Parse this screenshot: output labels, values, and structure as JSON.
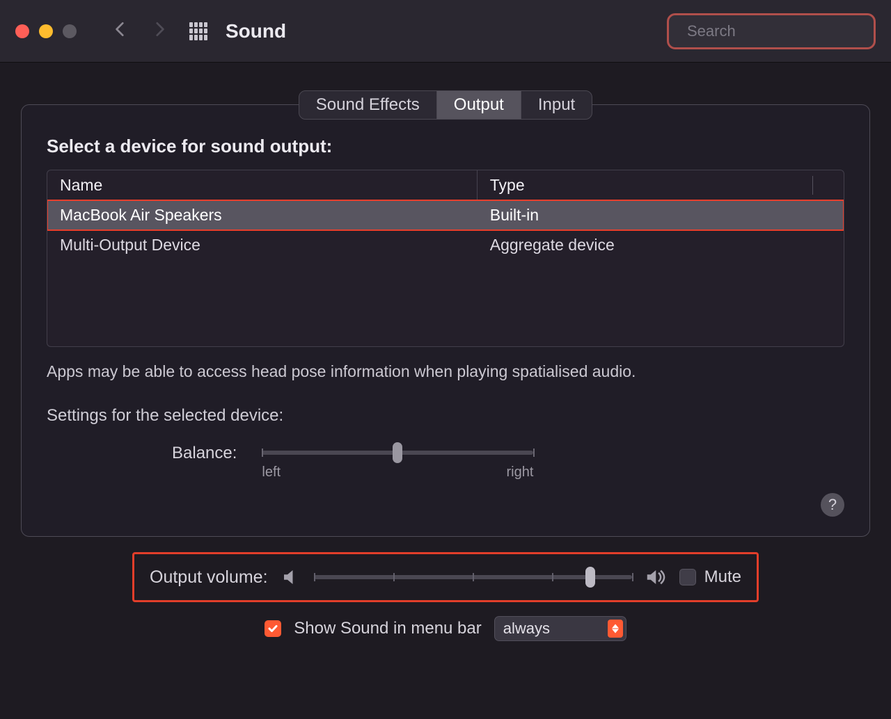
{
  "header": {
    "title": "Sound",
    "search_placeholder": "Search"
  },
  "tabs": {
    "sound_effects": "Sound Effects",
    "output": "Output",
    "input": "Input",
    "active": "output"
  },
  "output_panel": {
    "select_device_title": "Select a device for sound output:",
    "columns": {
      "name": "Name",
      "type": "Type"
    },
    "devices": [
      {
        "name": "MacBook Air Speakers",
        "type": "Built-in",
        "selected": true
      },
      {
        "name": "Multi-Output Device",
        "type": "Aggregate device",
        "selected": false
      }
    ],
    "spatial_note": "Apps may be able to access head pose information when playing spatialised audio.",
    "settings_heading": "Settings for the selected device:",
    "balance": {
      "label": "Balance:",
      "left_label": "left",
      "right_label": "right",
      "value": 0.5
    }
  },
  "volume": {
    "label": "Output volume:",
    "value": 0.87,
    "mute_label": "Mute",
    "muted": false
  },
  "menubar": {
    "checkbox_label": "Show Sound in menu bar",
    "checked": true,
    "select_value": "always"
  }
}
